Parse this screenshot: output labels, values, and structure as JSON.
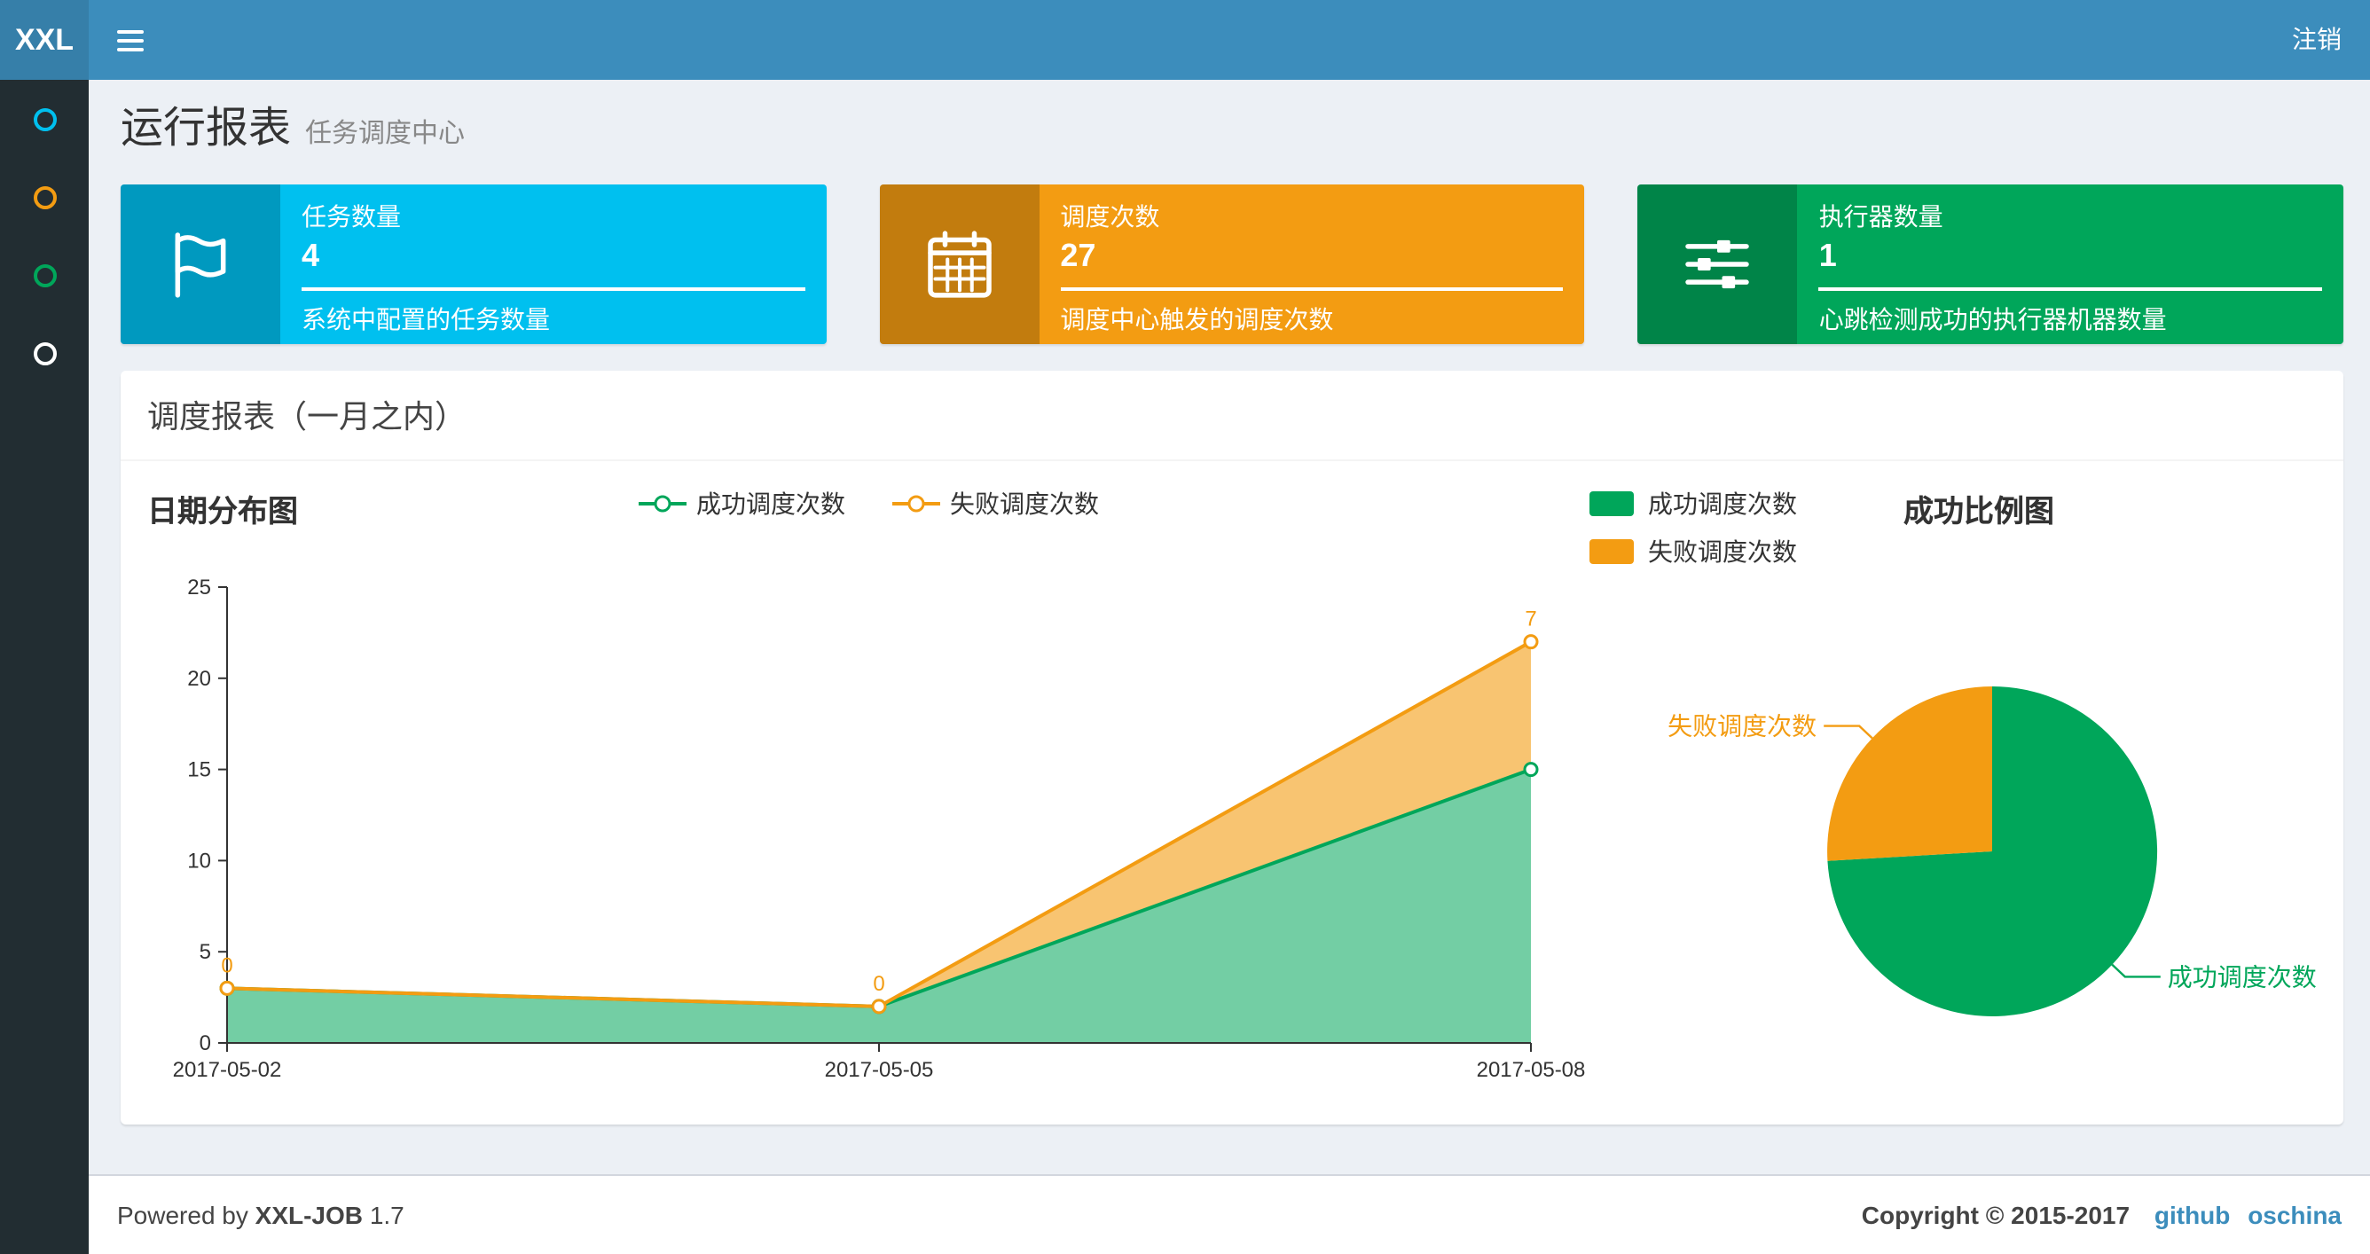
{
  "header": {
    "logo": "XXL",
    "logout": "注销"
  },
  "sidebar": {
    "items": [
      {
        "id": "item-1",
        "icon_color": "#00c0ef"
      },
      {
        "id": "item-2",
        "icon_color": "#f39c12"
      },
      {
        "id": "item-3",
        "icon_color": "#00a65a"
      },
      {
        "id": "item-4",
        "icon_color": "#ffffff"
      }
    ]
  },
  "page": {
    "title": "运行报表",
    "subtitle": "任务调度中心"
  },
  "info_boxes": [
    {
      "label": "任务数量",
      "value": "4",
      "desc": "系统中配置的任务数量",
      "color": "#00c0ef",
      "icon": "flag-icon"
    },
    {
      "label": "调度次数",
      "value": "27",
      "desc": "调度中心触发的调度次数",
      "color": "#f39c12",
      "icon": "calendar-icon"
    },
    {
      "label": "执行器数量",
      "value": "1",
      "desc": "心跳检测成功的执行器机器数量",
      "color": "#00a65a",
      "icon": "sliders-icon"
    }
  ],
  "panel": {
    "title": "调度报表（一月之内）"
  },
  "chart_data": [
    {
      "type": "area",
      "title": "日期分布图",
      "x": [
        "2017-05-02",
        "2017-05-05",
        "2017-05-08"
      ],
      "series": [
        {
          "name": "成功调度次数",
          "values": [
            3,
            2,
            15
          ],
          "color": "#00a65a"
        },
        {
          "name": "失败调度次数",
          "values": [
            0,
            0,
            7
          ],
          "color": "#f39c12",
          "stacked": true,
          "point_labels": [
            "0",
            "0",
            "7"
          ]
        }
      ],
      "xlabel": "",
      "ylabel": "",
      "ylim": [
        0,
        25
      ],
      "yticks": [
        0,
        5,
        10,
        15,
        20,
        25
      ],
      "legend_position": "top-center",
      "grid": false
    },
    {
      "type": "pie",
      "title": "成功比例图",
      "slices": [
        {
          "name": "成功调度次数",
          "value": 20,
          "color": "#00a65a"
        },
        {
          "name": "失败调度次数",
          "value": 7,
          "color": "#f39c12"
        }
      ],
      "legend_position": "top-left",
      "start_angle": 90,
      "direction": "clockwise"
    }
  ],
  "footer": {
    "powered_prefix": "Powered by",
    "product": "XXL-JOB",
    "version": "1.7",
    "copyright": "Copyright © 2015-2017",
    "links": [
      {
        "label": "github"
      },
      {
        "label": "oschina"
      }
    ]
  }
}
